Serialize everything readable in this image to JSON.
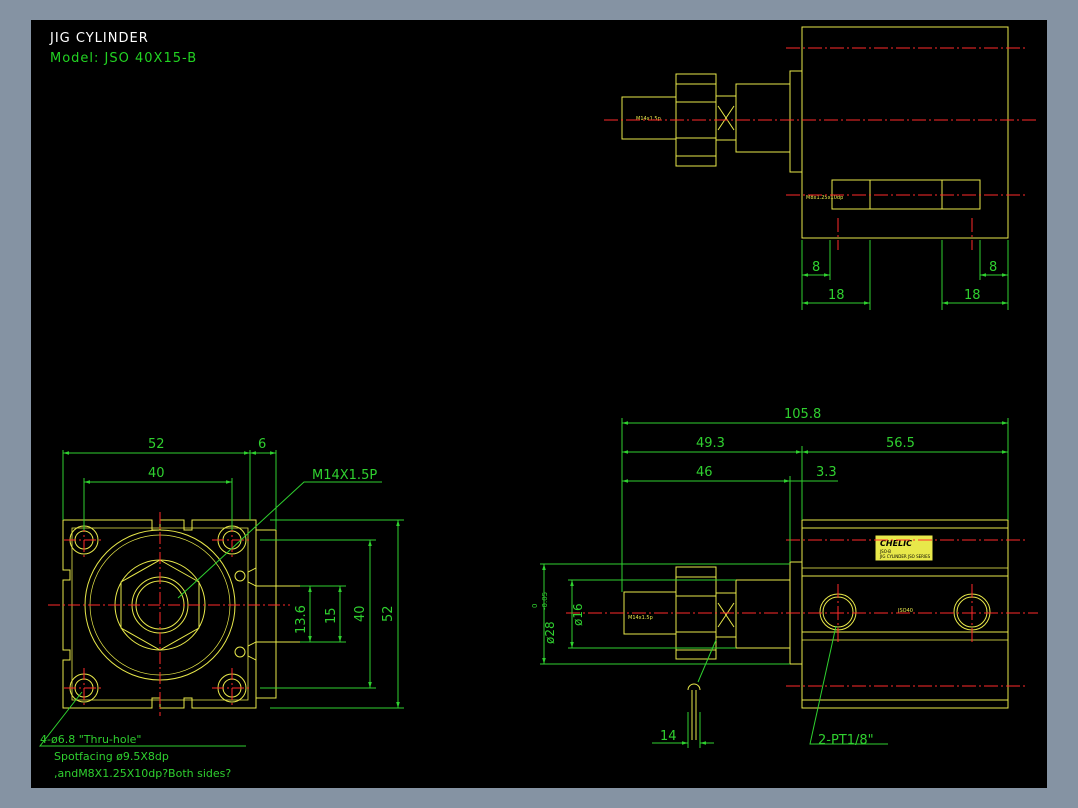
{
  "drawing": {
    "title": "JIG CYLINDER",
    "model": "Model: JSO 40X15-B"
  },
  "colors": {
    "background": "#000000",
    "frame": "#8593a3",
    "part": "#e8e84a",
    "dimension": "#2fd02f",
    "centerline": "#ff2a2a",
    "title": "#ffffff"
  },
  "top_view": {
    "rod_thread": "M14x1.5p",
    "port_note": "M8x1.25x10dp",
    "dim_left_8": "8",
    "dim_right_8": "8",
    "dim_left_18": "18",
    "dim_right_18": "18"
  },
  "front_view": {
    "dim_52_top": "52",
    "dim_6": "6",
    "dim_40_top": "40",
    "thread_callout": "M14X1.5P",
    "dim_13_6": "13.6",
    "dim_15": "15",
    "dim_40_side": "40",
    "dim_52_side": "52",
    "note_line1": "4-ø6.8 \"Thru-hole\"",
    "note_line2": "Spotfacing  ø9.5X8dp",
    "note_line3": ",andM8X1.25X10dp?Both sides?"
  },
  "side_view": {
    "dim_total": "105.8",
    "dim_49_3": "49.3",
    "dim_56_5": "56.5",
    "dim_46": "46",
    "dim_3_3": "3.3",
    "dim_rod_dia": "ø16",
    "dim_bore_dia": "ø28",
    "dim_tol_upper": "0",
    "dim_tol_lower": "-0.05",
    "dim_14": "14",
    "port_callout": "2-PT1/8\"",
    "rod_thread": "M14x1.5p",
    "brand": "CHELIC",
    "label_line1": "JSO-B",
    "label_line2": "JIG CYLINDER  JSO SERIES",
    "port_text": "JSO40"
  }
}
